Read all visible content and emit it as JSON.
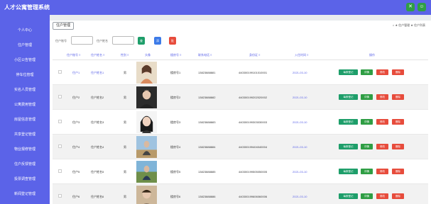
{
  "app": {
    "title": "人才公寓管理系统",
    "controls": [
      "✕",
      "☺"
    ]
  },
  "sidebar": {
    "items": [
      {
        "label": "个人中心"
      },
      {
        "label": "住户管理"
      },
      {
        "label": "小区公告管理"
      },
      {
        "label": "停车位管理"
      },
      {
        "label": "实名人员管理"
      },
      {
        "label": "公寓费用管理"
      },
      {
        "label": "房屋信息管理"
      },
      {
        "label": "共享登记管理"
      },
      {
        "label": "物业报修管理"
      },
      {
        "label": "住户反馈管理"
      },
      {
        "label": "投票调查管理"
      },
      {
        "label": "新闻登记管理"
      }
    ]
  },
  "main": {
    "tab_label": "住户管理",
    "breadcrumb": {
      "home": "⌂",
      "sep1": "★",
      "level1": "住户管理",
      "sep2": "★",
      "level2": "住户列表"
    },
    "search": {
      "field1_label": "住户账号",
      "field2_label": "住户姓名",
      "query_button": "查询",
      "add_button": "添加",
      "bulk_delete_button": "批量删除"
    },
    "table": {
      "headers": {
        "account": "住户账号 ≡",
        "name": "住户姓名 ≡",
        "gender": "性别 ≡",
        "avatar": "头像",
        "room": "楼房号 ≡",
        "phone": "联系电话 ≡",
        "id_card": "身份证 ≡",
        "checkin": "入住时间 ≡",
        "actions": "操作"
      },
      "action_labels": {
        "checkin": "每条登记",
        "detail": "详情",
        "edit": "修改",
        "delete": "删除"
      },
      "rows": [
        {
          "account": "住户1",
          "name": "住户姓名1",
          "gender": "男",
          "room": "楼房号1",
          "phone": "13823888881",
          "id_card": "440300199101010001",
          "checkin": "2021-03-10"
        },
        {
          "account": "住户2",
          "name": "住户姓名2",
          "gender": "男",
          "room": "楼房号2",
          "phone": "13823888882",
          "id_card": "440300199202020002",
          "checkin": "2021-03-10"
        },
        {
          "account": "住户3",
          "name": "住户姓名3",
          "gender": "男",
          "room": "楼房号3",
          "phone": "13823888883",
          "id_card": "440300199303030003",
          "checkin": "2021-03-10"
        },
        {
          "account": "住户4",
          "name": "住户姓名4",
          "gender": "男",
          "room": "楼房号4",
          "phone": "13823888884",
          "id_card": "440300199404040004",
          "checkin": "2021-03-10"
        },
        {
          "account": "住户5",
          "name": "住户姓名5",
          "gender": "男",
          "room": "楼房号5",
          "phone": "13823888885",
          "id_card": "440300199505050005",
          "checkin": "2021-03-10"
        },
        {
          "account": "住户6",
          "name": "住户姓名6",
          "gender": "男",
          "room": "楼房号6",
          "phone": "13823888886",
          "id_card": "440300199606060006",
          "checkin": "2021-03-10"
        }
      ]
    }
  },
  "colors": {
    "primary": "#5b63e8",
    "green": "#2f9e44",
    "blue": "#3d7be8",
    "red": "#e74c3c",
    "success": "#1e9e6a"
  }
}
